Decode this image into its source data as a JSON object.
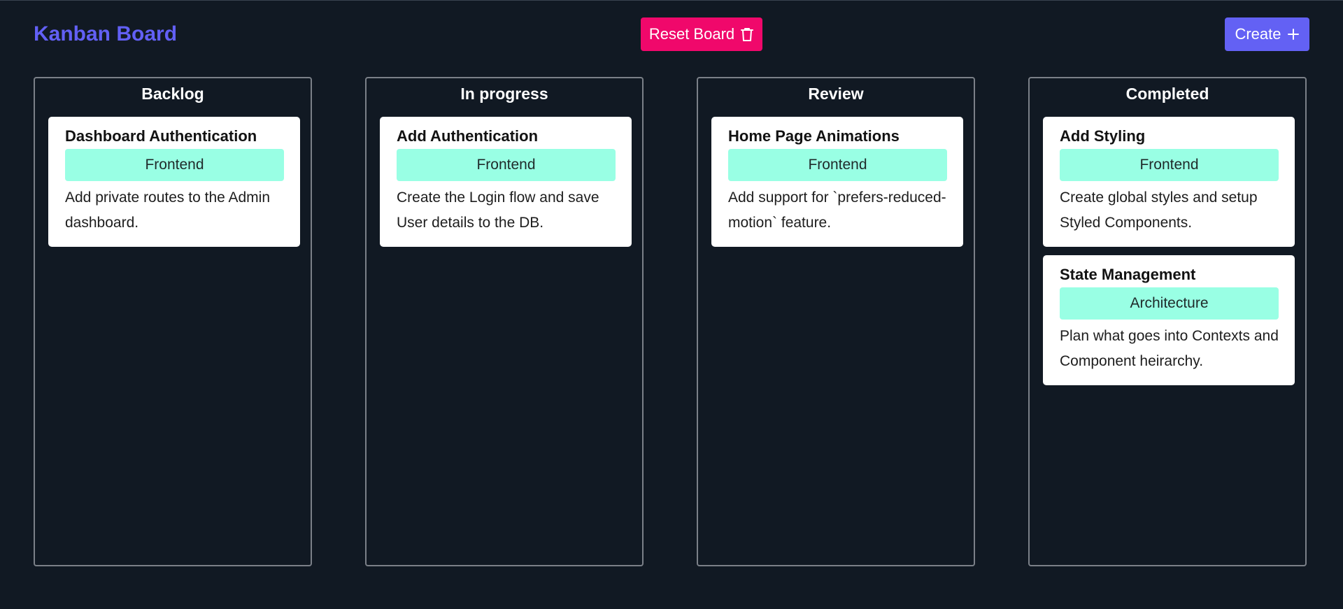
{
  "app": {
    "title": "Kanban Board",
    "reset_label": "Reset Board",
    "create_label": "Create"
  },
  "columns": [
    {
      "title": "Backlog",
      "cards": [
        {
          "title": "Dashboard Authentication",
          "tag": "Frontend",
          "description": "Add private routes to the Admin dashboard."
        }
      ]
    },
    {
      "title": "In progress",
      "cards": [
        {
          "title": "Add Authentication",
          "tag": "Frontend",
          "description": "Create the Login flow and save User details to the DB."
        }
      ]
    },
    {
      "title": "Review",
      "cards": [
        {
          "title": "Home Page Animations",
          "tag": "Frontend",
          "description": "Add support for `prefers-reduced-motion` feature."
        }
      ]
    },
    {
      "title": "Completed",
      "cards": [
        {
          "title": "Add Styling",
          "tag": "Frontend",
          "description": "Create global styles and setup Styled Components."
        },
        {
          "title": "State Management",
          "tag": "Architecture",
          "description": "Plan what goes into Contexts and Component heirarchy."
        }
      ]
    }
  ],
  "colors": {
    "background": "#111923",
    "brand": "#6260f5",
    "reset": "#f0086b",
    "create": "#6361f4",
    "tag": "#99ffe4",
    "column_border": "#7b8088"
  },
  "icons": {
    "reset": "trash-icon",
    "create": "plus-icon"
  }
}
